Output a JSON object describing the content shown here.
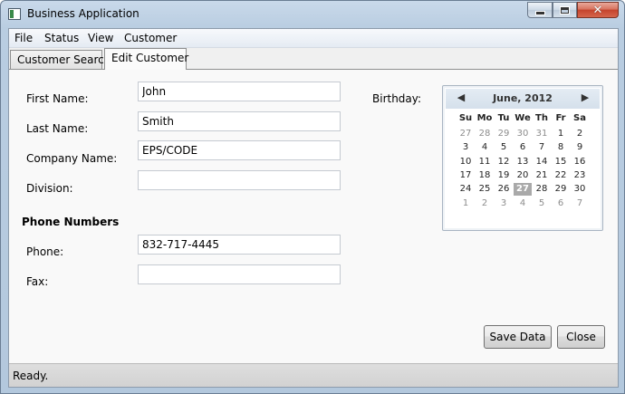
{
  "window": {
    "title": "Business Application"
  },
  "menu": [
    "File",
    "Status",
    "View",
    "Customer"
  ],
  "tabs": [
    {
      "label": "Customer Search",
      "active": false
    },
    {
      "label": "Edit Customer",
      "active": true
    }
  ],
  "form": {
    "first_name": {
      "label": "First Name:",
      "value": "John"
    },
    "last_name": {
      "label": "Last Name:",
      "value": "Smith"
    },
    "company_name": {
      "label": "Company Name:",
      "value": "EPS/CODE"
    },
    "division": {
      "label": "Division:",
      "value": ""
    },
    "phone_section": "Phone Numbers",
    "phone": {
      "label": "Phone:",
      "value": "832-717-4445"
    },
    "fax": {
      "label": "Fax:",
      "value": ""
    },
    "birthday_label": "Birthday:"
  },
  "calendar": {
    "month_title": "June, 2012",
    "prev_icon": "triangle-left-icon",
    "next_icon": "triangle-right-icon",
    "weekdays": [
      "Su",
      "Mo",
      "Tu",
      "We",
      "Th",
      "Fr",
      "Sa"
    ],
    "weeks": [
      [
        "27",
        "28",
        "29",
        "30",
        "31",
        "1",
        "2"
      ],
      [
        "3",
        "4",
        "5",
        "6",
        "7",
        "8",
        "9"
      ],
      [
        "10",
        "11",
        "12",
        "13",
        "14",
        "15",
        "16"
      ],
      [
        "17",
        "18",
        "19",
        "20",
        "21",
        "22",
        "23"
      ],
      [
        "24",
        "25",
        "26",
        "27",
        "28",
        "29",
        "30"
      ],
      [
        "1",
        "2",
        "3",
        "4",
        "5",
        "6",
        "7"
      ]
    ],
    "selected_day": "27"
  },
  "buttons": {
    "save": "Save Data",
    "close": "Close"
  },
  "status": {
    "text": "Ready."
  },
  "colors": {
    "selected_day_bg": "#a9a9a9",
    "close_button": "#c4432c"
  }
}
